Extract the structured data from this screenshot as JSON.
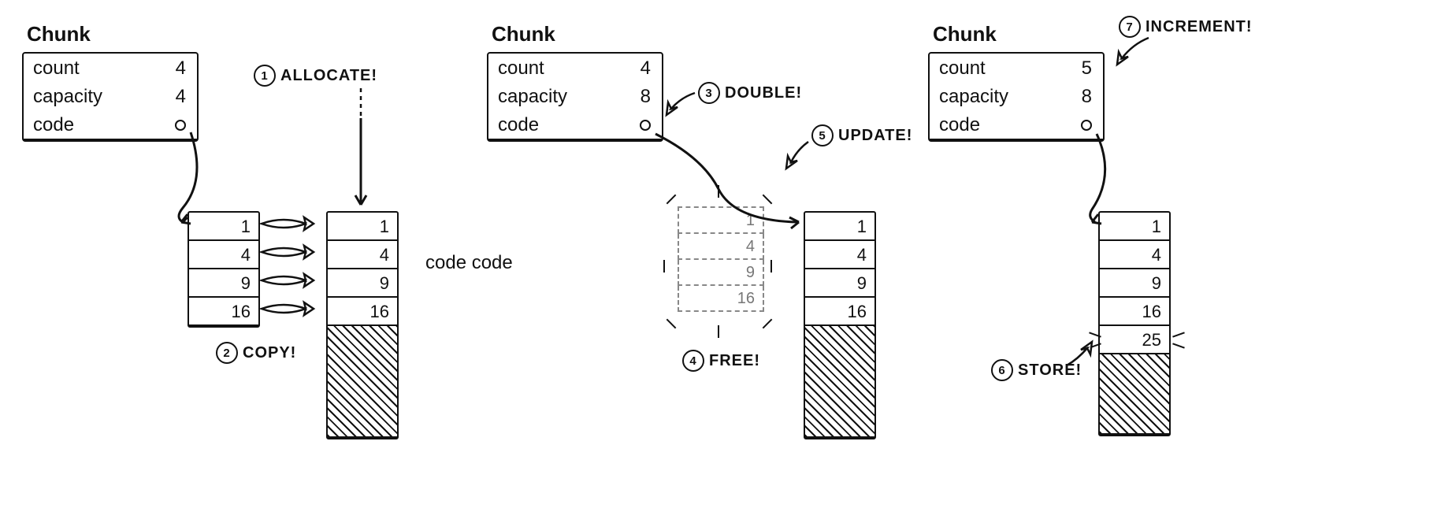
{
  "panels": {
    "a": {
      "title": "Chunk",
      "count": "4",
      "capacity": "4",
      "code_label": "code"
    },
    "b": {
      "title": "Chunk",
      "count": "4",
      "capacity": "8",
      "code_label": "code"
    },
    "c": {
      "title": "Chunk",
      "count": "5",
      "capacity": "8",
      "code_label": "code"
    }
  },
  "old_array": {
    "0": "1",
    "1": "4",
    "2": "9",
    "3": "16"
  },
  "new_array_a": {
    "0": "1",
    "1": "4",
    "2": "9",
    "3": "16"
  },
  "freed_array": {
    "0": "1",
    "1": "4",
    "2": "9",
    "3": "16"
  },
  "new_array_b": {
    "0": "1",
    "1": "4",
    "2": "9",
    "3": "16"
  },
  "final_array": {
    "0": "1",
    "1": "4",
    "2": "9",
    "3": "16",
    "4": "25"
  },
  "steps": {
    "1": "ALLOCATE!",
    "2": "COPY!",
    "3": "DOUBLE!",
    "4": "FREE!",
    "5": "UPDATE!",
    "6": "STORE!",
    "7": "INCREMENT!"
  },
  "floating": {
    "code_code": "code  code"
  }
}
